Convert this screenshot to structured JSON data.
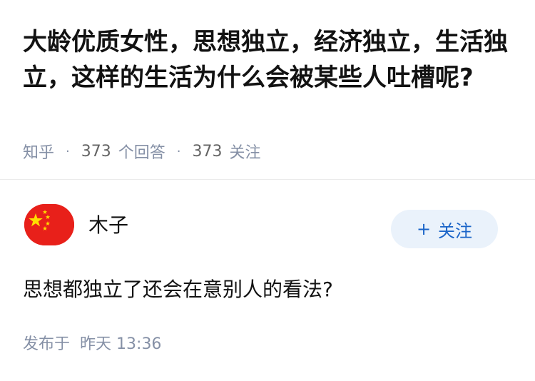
{
  "question": {
    "title": "大龄优质女性，思想独立，经济独立，生活独立，这样的生活为什么会被某些人吐槽呢?",
    "source": "知乎",
    "separator": "·",
    "answers_count": "373",
    "answers_label": "个回答",
    "followers_count": "373",
    "followers_label": "关注"
  },
  "answer": {
    "author": {
      "name": "木子",
      "avatar_icon": "china-flag-avatar",
      "avatar_colors": {
        "red": "#e8201a",
        "star": "#ffde00"
      }
    },
    "follow_button": {
      "plus": "+",
      "label": "关注"
    },
    "content": "思想都独立了还会在意别人的看法?",
    "published_prefix": "发布于",
    "published_day": "昨天",
    "published_time": "13:36"
  },
  "colors": {
    "title_text": "#121212",
    "meta_text": "#8590a6",
    "follow_bg": "#eaf2fb",
    "follow_text": "#1a64c8",
    "divider": "#ebebeb"
  }
}
